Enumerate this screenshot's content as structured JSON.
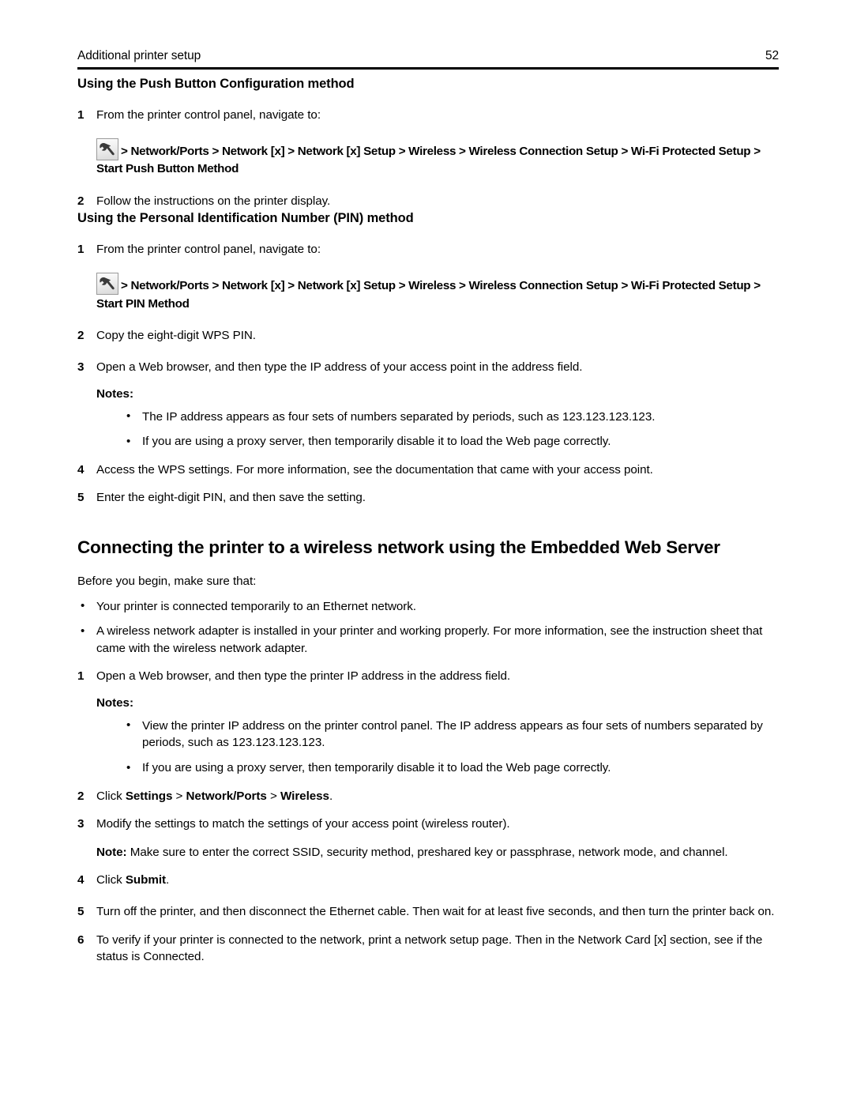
{
  "header": {
    "title": "Additional printer setup",
    "folio": "52"
  },
  "pbc_section": {
    "heading": "Using the Push Button Configuration method",
    "step1": {
      "num": "1",
      "text": "From the printer control panel, navigate to:"
    },
    "navpath": {
      "icon": "wrench-icon",
      "text": "> Network/Ports > Network [x] > Network [x] Setup > Wireless > Wireless Connection Setup > Wi-Fi Protected Setup > Start Push Button Method"
    },
    "step2": {
      "num": "2",
      "text": "Follow the instructions on the printer display."
    }
  },
  "pin_section": {
    "heading": "Using the Personal Identification Number (PIN) method",
    "step1": {
      "num": "1",
      "text": "From the printer control panel, navigate to:"
    },
    "navpath": {
      "icon": "wrench-icon",
      "text": "> Network/Ports > Network [x] > Network [x] Setup > Wireless > Wireless Connection Setup > Wi-Fi Protected Setup > Start PIN Method"
    },
    "step2": {
      "num": "2",
      "text": "Copy the eight-digit WPS PIN."
    },
    "step3": {
      "num": "3",
      "text": "Open a Web browser, and then type the IP address of your access point in the address field."
    },
    "notes_label": "Notes:",
    "notes": [
      "The IP address appears as four sets of numbers separated by periods, such as 123.123.123.123.",
      "If you are using a proxy server, then temporarily disable it to load the Web page correctly."
    ],
    "step4": {
      "num": "4",
      "text": "Access the WPS settings. For more information, see the documentation that came with your access point."
    },
    "step5": {
      "num": "5",
      "text": "Enter the eight-digit PIN, and then save the setting."
    }
  },
  "ews_section": {
    "heading": "Connecting the printer to a wireless network using the Embedded Web Server",
    "intro": "Before you begin, make sure that:",
    "prereqs": [
      "Your printer is connected temporarily to an Ethernet network.",
      "A wireless network adapter is installed in your printer and working properly. For more information, see the instruction sheet that came with the wireless network adapter."
    ],
    "step1": {
      "num": "1",
      "text": "Open a Web browser, and then type the printer IP address in the address field."
    },
    "notes_label": "Notes:",
    "notes": [
      "View the printer IP address on the printer control panel. The IP address appears as four sets of numbers separated by periods, such as 123.123.123.123.",
      "If you are using a proxy server, then temporarily disable it to load the Web page correctly."
    ],
    "step2": {
      "num": "2",
      "prefix": "Click ",
      "bold1": "Settings",
      "sep1": " > ",
      "bold2": "Network/Ports",
      "sep2": " > ",
      "bold3": "Wireless",
      "suffix": "."
    },
    "step3": {
      "num": "3",
      "text": "Modify the settings to match the settings of your access point (wireless router)."
    },
    "note_inline": {
      "label": "Note:",
      "text": " Make sure to enter the correct SSID, security method, preshared key or passphrase, network mode, and channel."
    },
    "step4": {
      "num": "4",
      "prefix": "Click ",
      "bold1": "Submit",
      "suffix": "."
    },
    "step5": {
      "num": "5",
      "text": "Turn off the printer, and then disconnect the Ethernet cable. Then wait for at least five seconds, and then turn the printer back on."
    },
    "step6": {
      "num": "6",
      "text": "To verify if your printer is connected to the network, print a network setup page. Then in the Network Card [x] section, see if the status is Connected."
    }
  },
  "glyphs": {
    "bullet": "•"
  },
  "colors": {
    "text": "#000000",
    "rule": "#000000",
    "icon_border": "#9a9a9a"
  }
}
